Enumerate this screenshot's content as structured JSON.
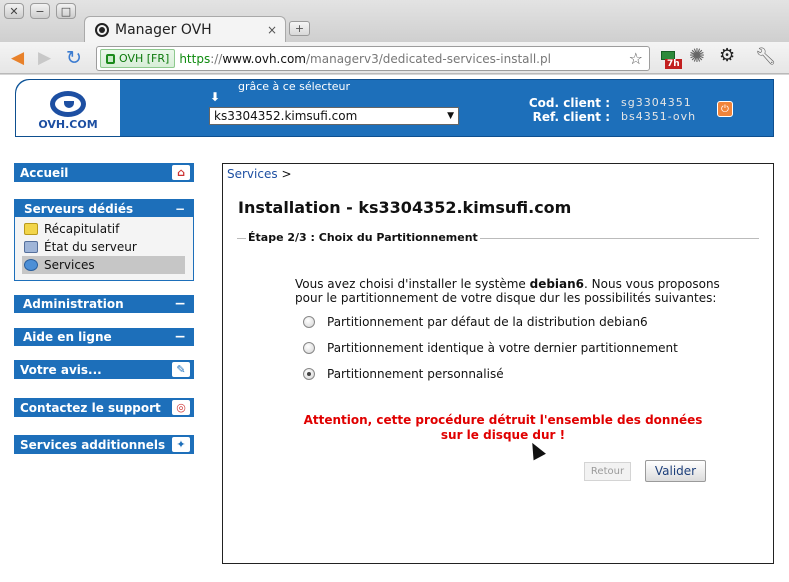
{
  "browser": {
    "window_buttons": [
      "✕",
      "−",
      "□"
    ],
    "tab_title": "Manager OVH",
    "tab_close": "×",
    "new_tab": "+",
    "ssl_label": "OVH [FR]",
    "url_scheme": "https",
    "url_sep": "://",
    "url_host": "www.ovh.com",
    "url_path": "/managerv3/dedicated-services-install.pl",
    "ext_badge": "7h",
    "icons": [
      "back-arrow-icon",
      "forward-arrow-icon",
      "reload-icon",
      "star-icon",
      "extension-icon",
      "settings-gear-icon",
      "chrome-icon",
      "wrench-icon"
    ]
  },
  "header": {
    "logo_text": "OVH.COM",
    "selector_hint": "grâce à ce sélecteur",
    "selected_server": "ks3304352.kimsufi.com",
    "cod_client_label": "Cod. client :",
    "ref_client_label": "Ref. client :",
    "cod_client_value": "sg3304351",
    "ref_client_value": "bs4351-ovh"
  },
  "sidebar": {
    "accueil": "Accueil",
    "serveurs_dedies": {
      "title": "Serveurs dédiés",
      "items": [
        {
          "label": "Récapitulatif"
        },
        {
          "label": "État du serveur"
        },
        {
          "label": "Services"
        }
      ]
    },
    "administration": "Administration",
    "aide": "Aide en ligne",
    "votre_avis": "Votre avis...",
    "support": "Contactez le support",
    "services_add": "Services additionnels",
    "collapse_symbol": "−"
  },
  "content": {
    "breadcrumb_link": "Services",
    "breadcrumb_sep": ">",
    "title_prefix": "Installation - ",
    "title_server": "ks3304352.kimsufi.com",
    "step": "Étape 2/3 : Choix du Partitionnement",
    "intro_before": "Vous avez choisi d'installer le système ",
    "intro_os": "debian6",
    "intro_after": ". Nous vous proposons pour le partitionnement de votre disque dur les possibilités suivantes:",
    "options": [
      {
        "label": "Partitionnement par défaut de la distribution debian6",
        "selected": false
      },
      {
        "label": "Partitionnement identique à votre dernier partitionnement",
        "selected": false
      },
      {
        "label": "Partitionnement personnalisé",
        "selected": true
      }
    ],
    "warning": "Attention, cette procédure détruit l'ensemble des données sur le disque dur !",
    "retour_button": "Retour",
    "valider_button": "Valider"
  },
  "colors": {
    "ovh_blue": "#1d6fba",
    "warning_red": "#e00000",
    "ssl_green": "#0d8a0d"
  }
}
